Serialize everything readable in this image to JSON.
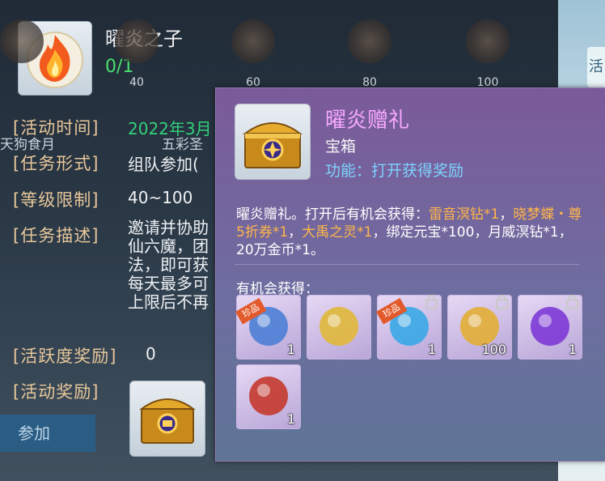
{
  "quest": {
    "title": "曜炎之子",
    "progress": "0/1",
    "milestones": [
      "40",
      "60",
      "80",
      "100"
    ],
    "day_label": "天狗食月",
    "wucai_label": "五彩圣",
    "rows": {
      "time_label": "[活动时间]",
      "time_value": "2022年3月",
      "form_label": "[任务形式]",
      "form_value": "组队参加(",
      "level_label": "[等级限制]",
      "level_value": "40~100",
      "desc_label": "[任务描述]",
      "desc_lines": [
        "邀请并协助",
        "仙六魔，团",
        "法，即可获",
        "每天最多可",
        "上限后不再"
      ],
      "activity_label": "[活跃度奖励]",
      "activity_value": "0",
      "reward_label": "[活动奖励]"
    },
    "join_button": "参加"
  },
  "side_tab": "活",
  "tooltip": {
    "title": "曜炎赠礼",
    "type": "宝箱",
    "function": "功能：打开获得奖励",
    "desc_prefix": "曜炎赠礼。打开后有机会获得：",
    "desc_items": [
      "雷音溟钻*1",
      "晓梦蝶・尊5折券*1",
      "大禹之灵*1",
      "绑定元宝*100",
      "月威溟钻*1",
      "20万金币*1"
    ],
    "desc_suffix": "。",
    "chance_label": "有机会获得：",
    "badge_text": "珍品",
    "items": [
      {
        "name": "ice-crystal-item",
        "count": "1",
        "badge": true,
        "lock": false,
        "color": "#4c7fd6"
      },
      {
        "name": "discount-ticket-item",
        "count": "",
        "badge": false,
        "lock": false,
        "color": "#e0b83a"
      },
      {
        "name": "spirit-orb-item",
        "count": "1",
        "badge": true,
        "lock": true,
        "color": "#3aa8e6"
      },
      {
        "name": "gold-ingot-item",
        "count": "100",
        "badge": false,
        "lock": true,
        "color": "#e2ae35"
      },
      {
        "name": "purple-gem-item",
        "count": "1",
        "badge": false,
        "lock": true,
        "color": "#7d3ad6"
      },
      {
        "name": "money-bag-item",
        "count": "1",
        "badge": false,
        "lock": false,
        "color": "#c43a2e"
      }
    ]
  }
}
